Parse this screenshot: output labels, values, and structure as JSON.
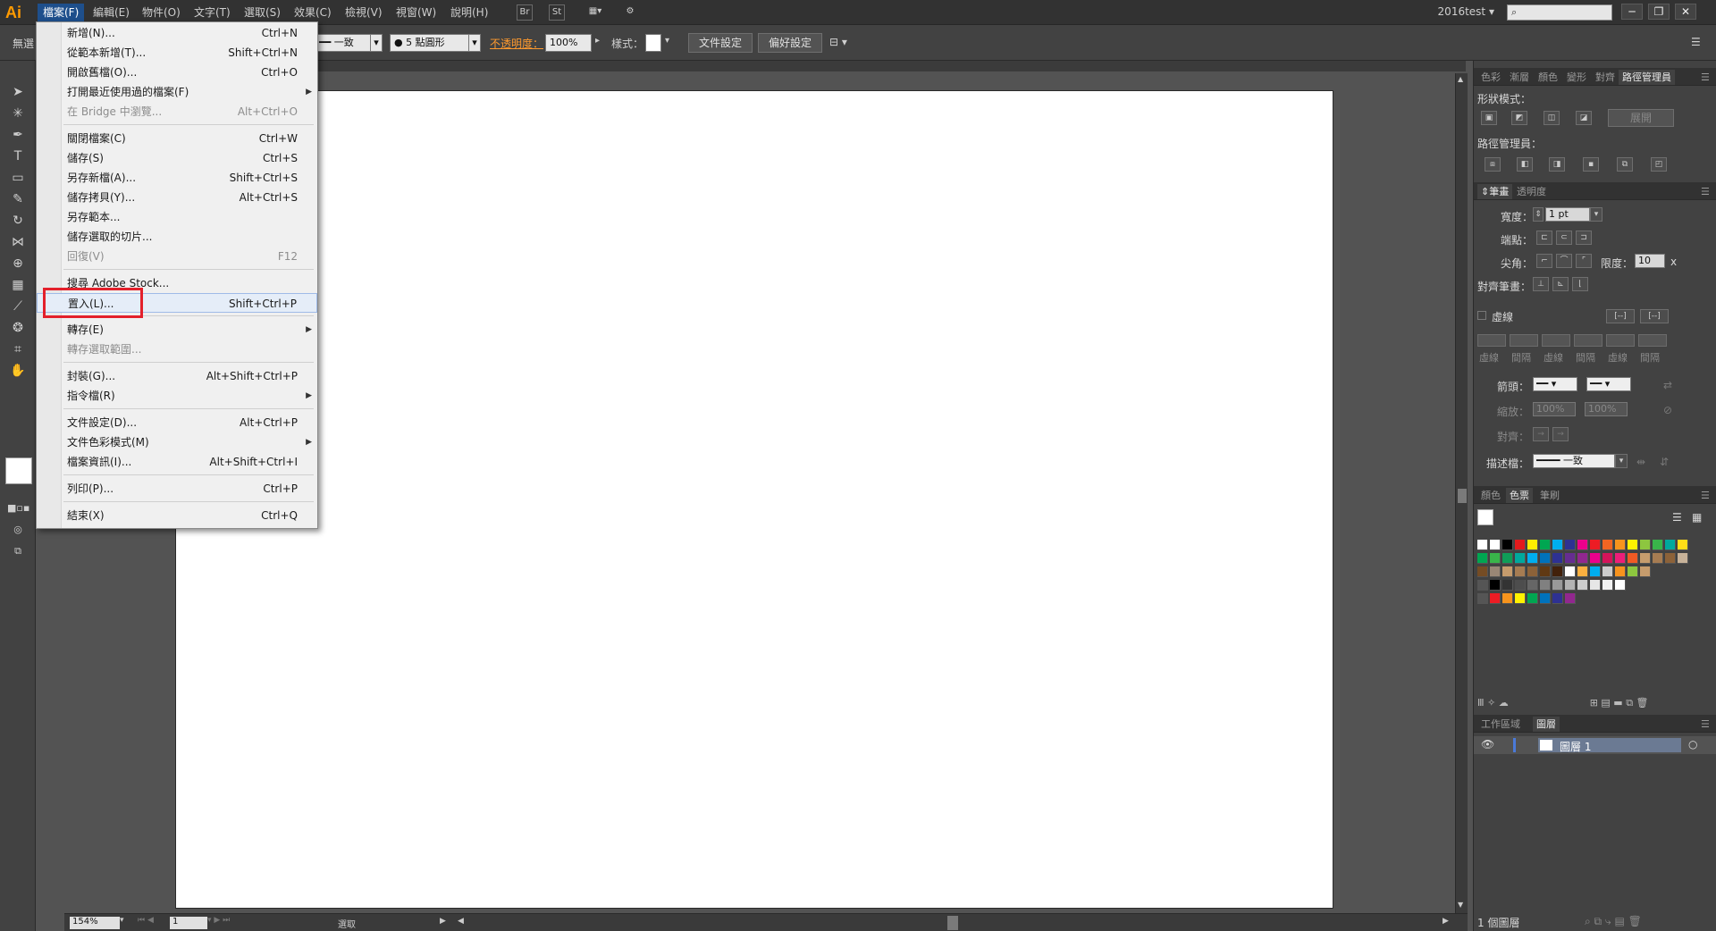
{
  "app": {
    "logo": "Ai"
  },
  "menubar": {
    "items": [
      "檔案(F)",
      "編輯(E)",
      "物件(O)",
      "文字(T)",
      "選取(S)",
      "效果(C)",
      "檢視(V)",
      "視窗(W)",
      "說明(H)"
    ],
    "icon_br": "Br",
    "icon_st": "St",
    "workspace": "2016test",
    "window_buttons": [
      "─",
      "❐",
      "✕"
    ]
  },
  "controlbar": {
    "left_label": "無選",
    "stroke_profile": "一致",
    "brush": "5 點圓形",
    "opacity_label": "不透明度：",
    "opacity_value": "100%",
    "style_label": "樣式：",
    "doc_setup": "文件設定",
    "preferences": "偏好設定"
  },
  "file_menu": {
    "items": [
      {
        "label": "新增(N)...",
        "shortcut": "Ctrl+N"
      },
      {
        "label": "從範本新增(T)...",
        "shortcut": "Shift+Ctrl+N"
      },
      {
        "label": "開啟舊檔(O)...",
        "shortcut": "Ctrl+O"
      },
      {
        "label": "打開最近使用過的檔案(F)",
        "shortcut": ""
      },
      {
        "label": "在 Bridge 中瀏覽...",
        "shortcut": "Alt+Ctrl+O"
      },
      {
        "label": "關閉檔案(C)",
        "shortcut": "Ctrl+W"
      },
      {
        "label": "儲存(S)",
        "shortcut": "Ctrl+S"
      },
      {
        "label": "另存新檔(A)...",
        "shortcut": "Shift+Ctrl+S"
      },
      {
        "label": "儲存拷貝(Y)...",
        "shortcut": "Alt+Ctrl+S"
      },
      {
        "label": "另存範本...",
        "shortcut": ""
      },
      {
        "label": "儲存選取的切片...",
        "shortcut": ""
      },
      {
        "label": "回復(V)",
        "shortcut": "F12"
      },
      {
        "label": "搜尋 Adobe Stock...",
        "shortcut": ""
      },
      {
        "label": "置入(L)...",
        "shortcut": "Shift+Ctrl+P"
      },
      {
        "label": "轉存(E)",
        "shortcut": ""
      },
      {
        "label": "轉存選取範圍...",
        "shortcut": ""
      },
      {
        "label": "封裝(G)...",
        "shortcut": "Alt+Shift+Ctrl+P"
      },
      {
        "label": "指令檔(R)",
        "shortcut": ""
      },
      {
        "label": "文件設定(D)...",
        "shortcut": "Alt+Ctrl+P"
      },
      {
        "label": "文件色彩模式(M)",
        "shortcut": ""
      },
      {
        "label": "檔案資訊(I)...",
        "shortcut": "Alt+Shift+Ctrl+I"
      },
      {
        "label": "列印(P)...",
        "shortcut": "Ctrl+P"
      },
      {
        "label": "結束(X)",
        "shortcut": "Ctrl+Q"
      }
    ]
  },
  "panels": {
    "top_tabs": [
      "色彩",
      "漸層",
      "顏色",
      "變形",
      "對齊",
      "路徑管理員"
    ],
    "shape_modes_label": "形狀模式：",
    "expand_button": "展開",
    "pathfinder_label": "路徑管理員：",
    "stroke_tabs": [
      "筆畫",
      "透明度"
    ],
    "weight_label": "寬度：",
    "weight_value": "1 pt",
    "cap_label": "端點：",
    "corner_label": "尖角：",
    "limit_label": "限度：",
    "limit_value": "10",
    "limit_unit": "x",
    "align_stroke_label": "對齊筆畫：",
    "dashed_label": "虛線",
    "dash_caps": [
      "虛線",
      "間隔",
      "虛線",
      "間隔",
      "虛線",
      "間隔"
    ],
    "arrowheads_label": "箭頭：",
    "scale_label": "縮放：",
    "scale_value_1": "100%",
    "scale_value_2": "100%",
    "align_label": "對齊：",
    "profile_label": "描述檔：",
    "profile_value": "一致",
    "swatch_tabs": [
      "顏色",
      "色票",
      "筆刷"
    ],
    "layer_tabs": [
      "工作區域",
      "圖層"
    ],
    "layer_name": "圖層 1",
    "layer_count": "1 個圖層"
  },
  "statusbar": {
    "zoom": "154%",
    "artboard": "1",
    "tool": "選取"
  },
  "colors": {
    "accent": "#1e4f8c",
    "highlight": "#e3202b",
    "opacity_link": "#ff9a2e"
  }
}
